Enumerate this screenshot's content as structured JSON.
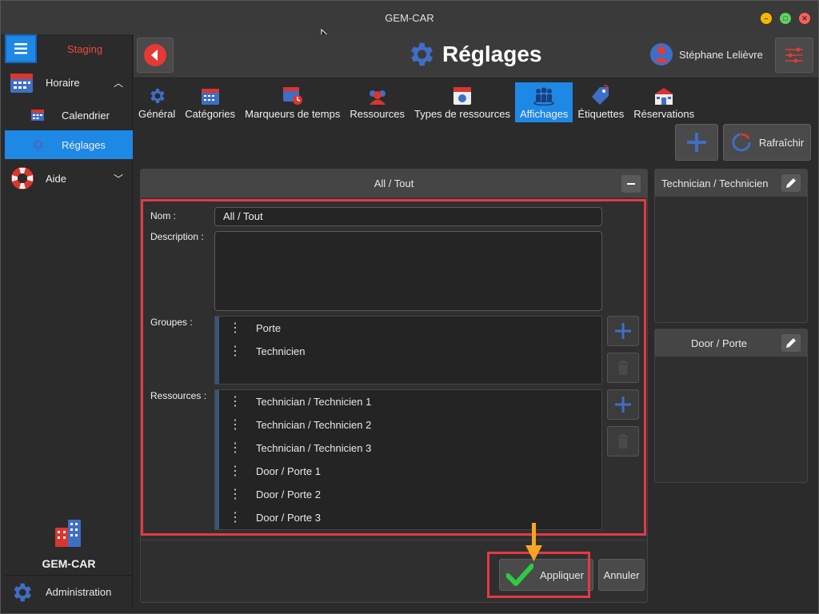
{
  "window": {
    "title": "GEM-CAR"
  },
  "sidebar": {
    "env_label": "Staging",
    "items": [
      {
        "label": "Horaire",
        "icon": "calendar-grid-icon"
      },
      {
        "label": "Calendrier",
        "icon": "calendar-icon"
      },
      {
        "label": "Réglages",
        "icon": "gear-icon"
      },
      {
        "label": "Aide",
        "icon": "lifebuoy-icon"
      }
    ],
    "brand_name": "GEM-CAR",
    "admin_label": "Administration"
  },
  "header": {
    "title": "Réglages",
    "user_name": "Stéphane Lelièvre"
  },
  "tabs": [
    {
      "label": "Général",
      "icon": "gear-icon"
    },
    {
      "label": "Catégories",
      "icon": "calendar-grid-icon"
    },
    {
      "label": "Marqueurs de temps",
      "icon": "calendar-clock-icon"
    },
    {
      "label": "Ressources",
      "icon": "people-icon"
    },
    {
      "label": "Types de ressources",
      "icon": "id-card-icon"
    },
    {
      "label": "Affichages",
      "icon": "group-icon",
      "active": true
    },
    {
      "label": "Étiquettes",
      "icon": "tag-icon"
    },
    {
      "label": "Réservations",
      "icon": "building-icon"
    }
  ],
  "toolbar": {
    "refresh_label": "Rafraîchir"
  },
  "panel": {
    "title": "All / Tout",
    "name_label": "Nom :",
    "name_value": "All / Tout",
    "description_label": "Description :",
    "description_value": "",
    "groups_label": "Groupes :",
    "groups": [
      "Porte",
      "Technicien"
    ],
    "resources_label": "Ressources :",
    "resources": [
      "Technician / Technicien 1",
      "Technician / Technicien 2",
      "Technician / Technicien 3",
      "Door / Porte 1",
      "Door / Porte 2",
      "Door / Porte 3"
    ],
    "apply_label": "Appliquer",
    "cancel_label": "Annuler"
  },
  "cards": [
    {
      "title": "Technician / Technicien"
    },
    {
      "title": "Door / Porte"
    }
  ],
  "colors": {
    "accent": "#1e88e5",
    "highlight": "#e53945",
    "arrow": "#f5a623",
    "success": "#2ecc40"
  }
}
